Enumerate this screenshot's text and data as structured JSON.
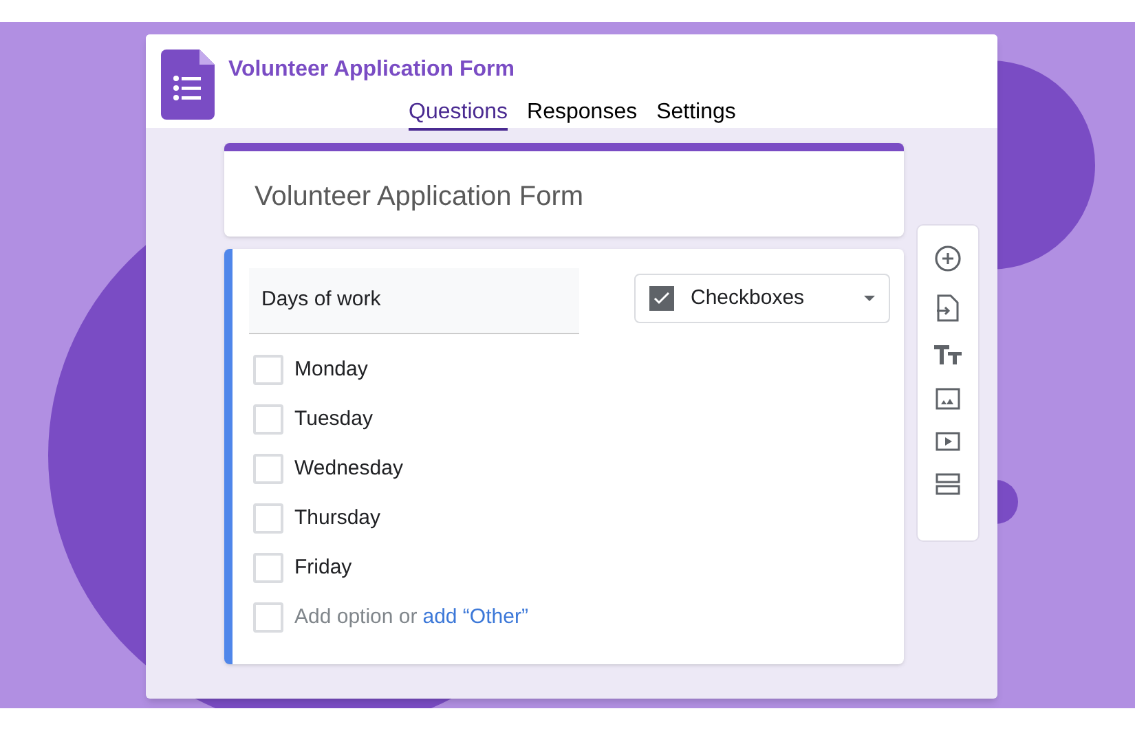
{
  "app_header": {
    "title": "Volunteer Application Form"
  },
  "tabs": [
    {
      "label": "Questions",
      "selected": true
    },
    {
      "label": "Responses",
      "selected": false
    },
    {
      "label": "Settings",
      "selected": false
    }
  ],
  "form_card": {
    "title": "Volunteer Application Form"
  },
  "question": {
    "title": "Days of work",
    "type_dropdown": {
      "label": "Checkboxes"
    },
    "options": [
      {
        "label": "Monday",
        "checked": false
      },
      {
        "label": "Tuesday",
        "checked": false
      },
      {
        "label": "Wednesday",
        "checked": false
      },
      {
        "label": "Thursday",
        "checked": false
      },
      {
        "label": "Friday",
        "checked": false
      }
    ],
    "add_option": {
      "checked": false,
      "text": "Add option or",
      "link": "add “Other”"
    }
  }
}
